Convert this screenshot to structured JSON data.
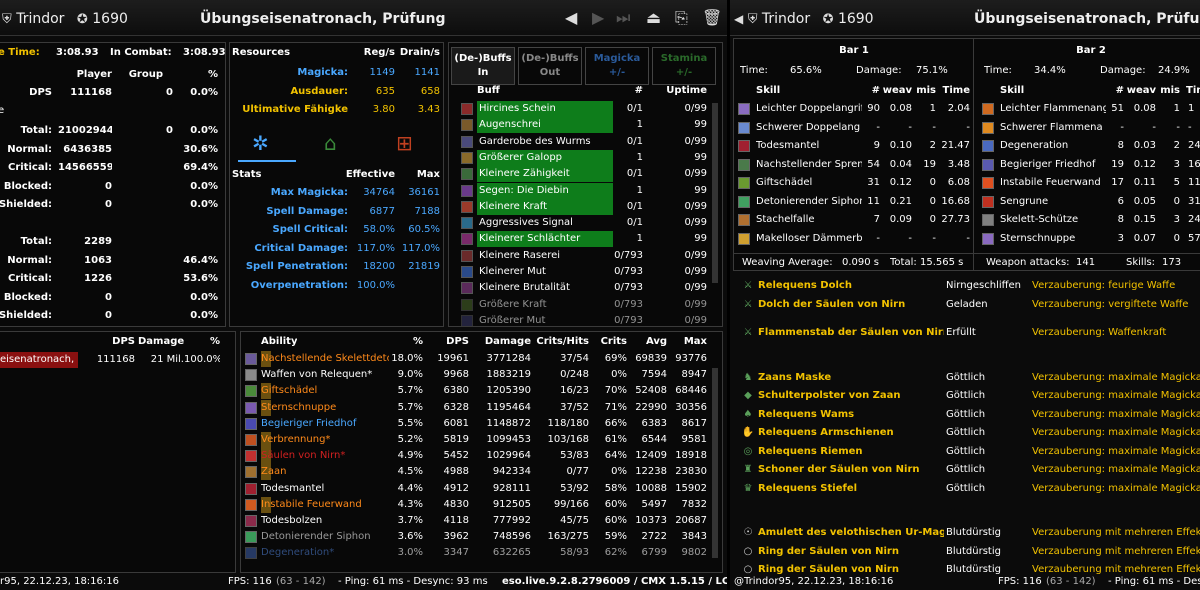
{
  "left": {
    "user": "Trindor",
    "cp": "1690",
    "title": "Übungseisenatronach, Prüfung",
    "time": {
      "active_label": "e Time:",
      "active": "3:08.93",
      "combat_label": "In Combat:",
      "combat": "3:08.93"
    },
    "dmg_head": {
      "player": "Player",
      "group": "Group",
      "pct": "%"
    },
    "dps_row": {
      "label": "DPS",
      "player": "111168",
      "group": "0",
      "pct": "0.0%"
    },
    "e_label": "e",
    "dmg_rows": [
      {
        "label": "Total:",
        "player": "21002944",
        "group": "0",
        "pct": "0.0%"
      },
      {
        "label": "Normal:",
        "player": "6436385",
        "group": "",
        "pct": "30.6%"
      },
      {
        "label": "Critical:",
        "player": "14566559",
        "group": "",
        "pct": "69.4%"
      },
      {
        "label": "Blocked:",
        "player": "0",
        "group": "",
        "pct": "0.0%"
      },
      {
        "label": "Shielded:",
        "player": "0",
        "group": "",
        "pct": "0.0%"
      }
    ],
    "hit_rows": [
      {
        "label": "Total:",
        "v": "2289",
        "pct": ""
      },
      {
        "label": "Normal:",
        "v": "1063",
        "pct": "46.4%"
      },
      {
        "label": "Critical:",
        "v": "1226",
        "pct": "53.6%"
      },
      {
        "label": "Blocked:",
        "v": "0",
        "pct": "0.0%"
      },
      {
        "label": "Shielded:",
        "v": "0",
        "pct": "0.0%"
      }
    ],
    "res_head": {
      "a": "Resources",
      "b": "Reg/s",
      "c": "Drain/s"
    },
    "res_rows": [
      {
        "label": "Magicka:",
        "reg": "1149",
        "drain": "1141",
        "cls": "blue"
      },
      {
        "label": "Ausdauer:",
        "reg": "635",
        "drain": "658",
        "cls": "gold"
      },
      {
        "label": "Ultimative Fähigke",
        "reg": "3.80",
        "drain": "3.43",
        "cls": "gold"
      }
    ],
    "stats_head": {
      "a": "Stats",
      "b": "Effective",
      "c": "Max"
    },
    "stats_rows": [
      {
        "label": "Max Magicka:",
        "eff": "34764",
        "max": "36161"
      },
      {
        "label": "Spell Damage:",
        "eff": "6877",
        "max": "7188"
      },
      {
        "label": "Spell Critical:",
        "eff": "58.0%",
        "max": "60.5%"
      },
      {
        "label": "Critical Damage:",
        "eff": "117.0%",
        "max": "117.0%"
      },
      {
        "label": "Spell Penetration:",
        "eff": "18200",
        "max": "21819"
      },
      {
        "label": "Overpenetration:",
        "eff": "100.0%",
        "max": ""
      }
    ],
    "buff_tabs": [
      "(De-)Buffs In",
      "(De-)Buffs Out",
      "Magicka +/-",
      "Stamina +/-"
    ],
    "buff_head": {
      "a": "Buff",
      "b": "#",
      "c": "Uptime"
    },
    "buffs": [
      {
        "name": "Hircines Schein",
        "n": "0/1",
        "up": "0/99",
        "g": 1
      },
      {
        "name": "Augenschrei",
        "n": "1",
        "up": "99",
        "g": 1
      },
      {
        "name": "Garderobe des Wurms",
        "n": "0/1",
        "up": "0/99",
        "g": 0
      },
      {
        "name": "Größerer Galopp",
        "n": "1",
        "up": "99",
        "g": 1
      },
      {
        "name": "Kleinere Zähigkeit",
        "n": "0/1",
        "up": "0/99",
        "g": 1
      },
      {
        "name": "Segen: Die Diebin",
        "n": "1",
        "up": "99",
        "g": 1
      },
      {
        "name": "Kleinere Kraft",
        "n": "0/1",
        "up": "0/99",
        "g": 1
      },
      {
        "name": "Aggressives Signal",
        "n": "0/1",
        "up": "0/99",
        "g": 0
      },
      {
        "name": "Kleinerer Schlächter",
        "n": "1",
        "up": "99",
        "g": 1
      },
      {
        "name": "Kleinere Raserei",
        "n": "0/793",
        "up": "0/99",
        "g": 0
      },
      {
        "name": "Kleinerer Mut",
        "n": "0/793",
        "up": "0/99",
        "g": 0
      },
      {
        "name": "Kleinere Brutalität",
        "n": "0/793",
        "up": "0/99",
        "g": 0
      },
      {
        "name": "Größere Kraft",
        "n": "0/793",
        "up": "0/99",
        "g": 0
      },
      {
        "name": "Größerer Mut",
        "n": "0/793",
        "up": "0/99",
        "g": 0
      }
    ],
    "targets_head": {
      "dps": "DPS",
      "dmg": "Damage",
      "pct": "%"
    },
    "target": {
      "name": "eisenatronach, P",
      "dps": "111168",
      "dmg": "21 Mil.",
      "pct": "100.0%"
    },
    "ab_head": {
      "a": "Ability",
      "b": "%",
      "c": "DPS",
      "d": "Damage",
      "e": "Crits/Hits",
      "f": "Crits",
      "g": "Avg",
      "h": "Max"
    },
    "abilities": [
      {
        "name": "Nachstellende Skelettdetonat",
        "pct": "18.0%",
        "dps": "19961",
        "dmg": "3771284",
        "ch": "37/54",
        "cr": "69%",
        "avg": "69839",
        "max": "93776",
        "col": "#ff8a1a",
        "hl": 1
      },
      {
        "name": "Waffen von Relequen*",
        "pct": "9.0%",
        "dps": "9968",
        "dmg": "1883219",
        "ch": "0/248",
        "cr": "0%",
        "avg": "7594",
        "max": "8947",
        "col": "#ffffff",
        "hl": 0
      },
      {
        "name": "Giftschädel",
        "pct": "5.7%",
        "dps": "6380",
        "dmg": "1205390",
        "ch": "16/23",
        "cr": "70%",
        "avg": "52408",
        "max": "68446",
        "col": "#ff8a1a",
        "hl": 1
      },
      {
        "name": "Sternschnuppe",
        "pct": "5.7%",
        "dps": "6328",
        "dmg": "1195464",
        "ch": "37/52",
        "cr": "71%",
        "avg": "22990",
        "max": "30356",
        "col": "#ff8a1a",
        "hl": 1
      },
      {
        "name": "Begieriger Friedhof",
        "pct": "5.5%",
        "dps": "6081",
        "dmg": "1148872",
        "ch": "118/180",
        "cr": "66%",
        "avg": "6383",
        "max": "8617",
        "col": "#4aa8ff",
        "hl": 0
      },
      {
        "name": "Verbrennung*",
        "pct": "5.2%",
        "dps": "5819",
        "dmg": "1099453",
        "ch": "103/168",
        "cr": "61%",
        "avg": "6544",
        "max": "9581",
        "col": "#ff8a1a",
        "hl": 1
      },
      {
        "name": "Säulen von Nirn*",
        "pct": "4.9%",
        "dps": "5452",
        "dmg": "1029964",
        "ch": "53/83",
        "cr": "64%",
        "avg": "12409",
        "max": "18918",
        "col": "#d02020",
        "hl": 1
      },
      {
        "name": "Zaan",
        "pct": "4.5%",
        "dps": "4988",
        "dmg": "942334",
        "ch": "0/77",
        "cr": "0%",
        "avg": "12238",
        "max": "23830",
        "col": "#ff8a1a",
        "hl": 1
      },
      {
        "name": "Todesmantel",
        "pct": "4.4%",
        "dps": "4912",
        "dmg": "928111",
        "ch": "53/92",
        "cr": "58%",
        "avg": "10088",
        "max": "15902",
        "col": "#ffffff",
        "hl": 0
      },
      {
        "name": "Instabile Feuerwand",
        "pct": "4.3%",
        "dps": "4830",
        "dmg": "912505",
        "ch": "99/166",
        "cr": "60%",
        "avg": "5497",
        "max": "7832",
        "col": "#ff8a1a",
        "hl": 1
      },
      {
        "name": "Todesbolzen",
        "pct": "3.7%",
        "dps": "4118",
        "dmg": "777992",
        "ch": "45/75",
        "cr": "60%",
        "avg": "10373",
        "max": "20687",
        "col": "#ffffff",
        "hl": 0
      },
      {
        "name": "Detonierender Siphon",
        "pct": "3.6%",
        "dps": "3962",
        "dmg": "748596",
        "ch": "163/275",
        "cr": "59%",
        "avg": "2722",
        "max": "3843",
        "col": "#999999",
        "hl": 0
      },
      {
        "name": "Degeneration*",
        "pct": "3.0%",
        "dps": "3347",
        "dmg": "632265",
        "ch": "58/93",
        "cr": "62%",
        "avg": "6799",
        "max": "9802",
        "col": "#4a78c8",
        "hl": 0
      }
    ],
    "footer": {
      "left": "r95, 22.12.23, 18:16:16",
      "fps": "FPS: 116",
      "fpsr": "(63 - 142)",
      "ping": "- Ping: 61 ms - Desync: 93 ms",
      "ver": "eso.live.9.2.8.2796009 / CMX 1.5.15 / LC 71"
    }
  },
  "right": {
    "user": "Trindor",
    "cp": "1690",
    "title": "Übungseisenatronach, Prüfung",
    "bar1": {
      "title": "Bar 1",
      "time_label": "Time:",
      "time": "65.6%",
      "dmg_label": "Damage:",
      "dmg": "75.1%"
    },
    "bar2": {
      "title": "Bar 2",
      "time_label": "Time:",
      "time": "34.4%",
      "dmg_label": "Damage:",
      "dmg": "24.9%"
    },
    "sk_head": {
      "a": "Skill",
      "b": "#",
      "c": "weav",
      "d": "mis",
      "e": "Time"
    },
    "bar1_skills": [
      {
        "name": "Leichter Doppelangrif",
        "n": "90",
        "w": "0.08",
        "m": "1",
        "t": "2.04",
        "c": "#8a6cc0"
      },
      {
        "name": "Schwerer Doppelang",
        "n": "-",
        "w": "-",
        "m": "-",
        "t": "-",
        "c": "#6a8ad0"
      },
      {
        "name": "Todesmantel",
        "n": "9",
        "w": "0.10",
        "m": "2",
        "t": "21.47",
        "c": "#a02030"
      },
      {
        "name": "Nachstellender Spren",
        "n": "54",
        "w": "0.04",
        "m": "19",
        "t": "3.48",
        "c": "#4a7a4a"
      },
      {
        "name": "Giftschädel",
        "n": "31",
        "w": "0.12",
        "m": "0",
        "t": "6.08",
        "c": "#6a9a30"
      },
      {
        "name": "Detonierender Siphon",
        "n": "11",
        "w": "0.21",
        "m": "0",
        "t": "16.68",
        "c": "#40a060"
      },
      {
        "name": "Stachelfalle",
        "n": "7",
        "w": "0.09",
        "m": "0",
        "t": "27.73",
        "c": "#b07030"
      },
      {
        "name": "Makelloser Dämmerb",
        "n": "-",
        "w": "-",
        "m": "-",
        "t": "-",
        "c": "#d0a030"
      }
    ],
    "bar2_skills": [
      {
        "name": "Leichter Flammenang",
        "n": "51",
        "w": "0.08",
        "m": "1",
        "t": "1",
        "c": "#d06a20"
      },
      {
        "name": "Schwerer Flammena",
        "n": "-",
        "w": "-",
        "m": "-",
        "t": "-",
        "c": "#e08a20"
      },
      {
        "name": "Degeneration",
        "n": "8",
        "w": "0.03",
        "m": "2",
        "t": "24",
        "c": "#4a6ac0"
      },
      {
        "name": "Begieriger Friedhof",
        "n": "19",
        "w": "0.12",
        "m": "3",
        "t": "16",
        "c": "#5a5ab0"
      },
      {
        "name": "Instabile Feuerwand",
        "n": "17",
        "w": "0.11",
        "m": "5",
        "t": "11",
        "c": "#e05020"
      },
      {
        "name": "Sengrune",
        "n": "6",
        "w": "0.05",
        "m": "0",
        "t": "31",
        "c": "#c03020"
      },
      {
        "name": "Skelett-Schütze",
        "n": "8",
        "w": "0.15",
        "m": "3",
        "t": "24",
        "c": "#808080"
      },
      {
        "name": "Sternschnuppe",
        "n": "3",
        "w": "0.07",
        "m": "0",
        "t": "57",
        "c": "#8a6ac0"
      }
    ],
    "weave": {
      "avg_label": "Weaving Average:",
      "avg": "0.090 s",
      "total_label": "Total:",
      "total": "15.565 s",
      "wa_label": "Weapon attacks:",
      "wa": "141",
      "sk_label": "Skills:",
      "sk": "173"
    },
    "gear": [
      {
        "name": "Relequens Dolch",
        "trait": "Nirngeschliffen",
        "ench": "Verzauberung: feurige Waffe",
        "icon": "dagger-icon",
        "gap": 0
      },
      {
        "name": "Dolch der Säulen von Nirn",
        "trait": "Geladen",
        "ench": "Verzauberung: vergiftete Waffe",
        "icon": "dagger-icon",
        "gap": 0
      },
      {
        "name": "Flammenstab der Säulen von Nirn",
        "trait": "Erfüllt",
        "ench": "Verzauberung: Waffenkraft",
        "icon": "staff-icon",
        "gap": 1
      },
      {
        "name": "Zaans Maske",
        "trait": "Göttlich",
        "ench": "Verzauberung: maximale Magicka",
        "icon": "helm-icon",
        "gap": 2
      },
      {
        "name": "Schulterpolster von Zaan",
        "trait": "Göttlich",
        "ench": "Verzauberung: maximale Magicka",
        "icon": "shoulder-icon",
        "gap": 0
      },
      {
        "name": "Relequens Wams",
        "trait": "Göttlich",
        "ench": "Verzauberung: maximale Magicka",
        "icon": "chest-icon",
        "gap": 0
      },
      {
        "name": "Relequens Armschienen",
        "trait": "Göttlich",
        "ench": "Verzauberung: maximale Magicka",
        "icon": "gloves-icon",
        "gap": 0
      },
      {
        "name": "Relequens Riemen",
        "trait": "Göttlich",
        "ench": "Verzauberung: maximale Magicka",
        "icon": "belt-icon",
        "gap": 0
      },
      {
        "name": "Schoner der Säulen von Nirn",
        "trait": "Göttlich",
        "ench": "Verzauberung: maximale Magicka",
        "icon": "legs-icon",
        "gap": 0
      },
      {
        "name": "Relequens Stiefel",
        "trait": "Göttlich",
        "ench": "Verzauberung: maximale Magicka",
        "icon": "boots-icon",
        "gap": 0
      },
      {
        "name": "Amulett des velothischen Ur-Magiers",
        "trait": "Blutdürstig",
        "ench": "Verzauberung mit mehreren Effekten",
        "icon": "amulet-icon",
        "gap": 2
      },
      {
        "name": "Ring der Säulen von Nirn",
        "trait": "Blutdürstig",
        "ench": "Verzauberung mit mehreren Effekten",
        "icon": "ring-icon",
        "gap": 0
      },
      {
        "name": "Ring der Säulen von Nirn",
        "trait": "Blutdürstig",
        "ench": "Verzauberung mit mehreren Effekten",
        "icon": "ring-icon",
        "gap": 0
      }
    ],
    "footer": {
      "left": "@Trindor95, 22.12.23, 18:16:16",
      "fps": "FPS: 116",
      "fpsr": "(63 - 142)",
      "ping": "- Ping: 61 ms - Desync:"
    }
  }
}
